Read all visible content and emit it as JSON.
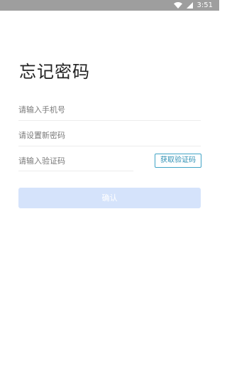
{
  "status_bar": {
    "time": "3:51",
    "icons": [
      "wifi-icon",
      "signal-icon"
    ],
    "background": "#9e9e9e"
  },
  "page": {
    "title": "忘记密码"
  },
  "form": {
    "phone_placeholder": "请输入手机号",
    "new_password_placeholder": "请设置新密码",
    "code_placeholder": "请输入验证码",
    "get_code_label": "获取验证码",
    "confirm_label": "确认"
  },
  "colors": {
    "accent": "#41a4c6",
    "confirm_disabled": "#d5e3fb",
    "title_text": "#222222"
  }
}
